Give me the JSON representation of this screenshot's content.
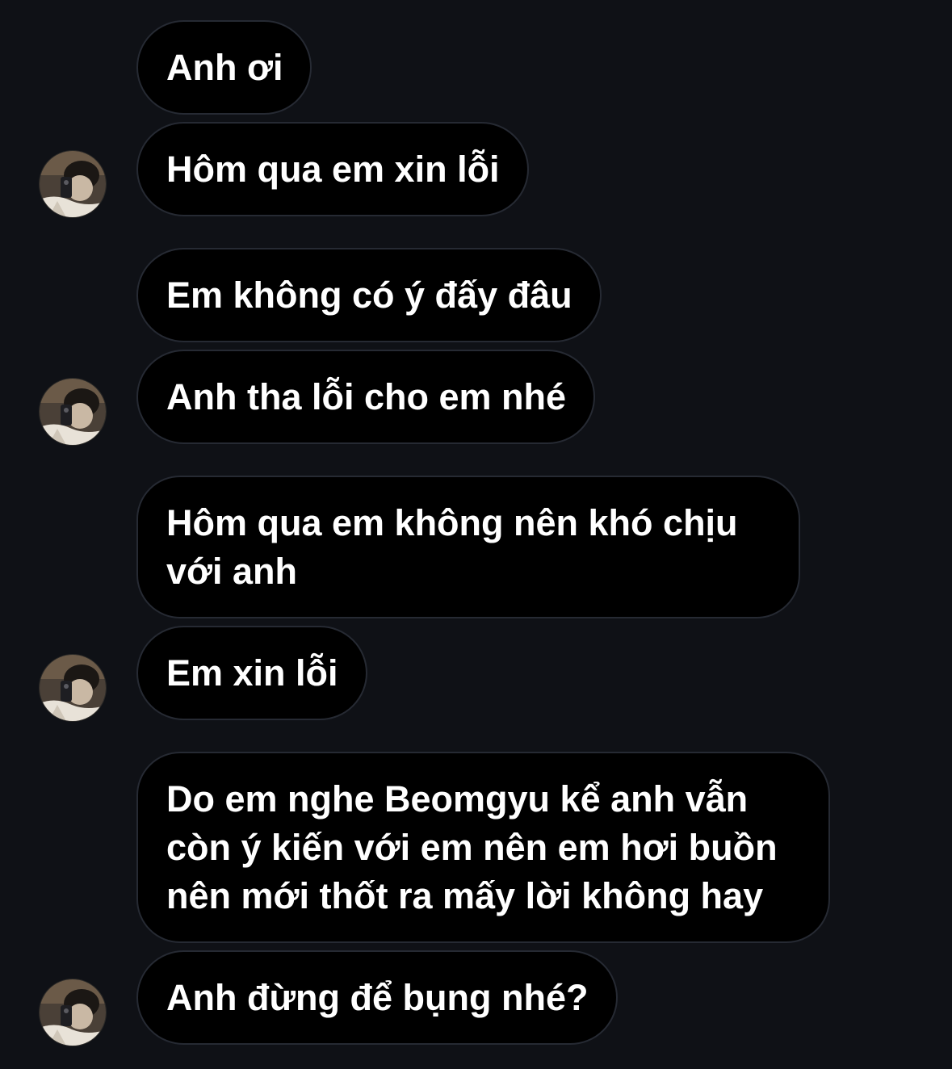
{
  "messages": [
    {
      "text_lines": [
        "Anh ơi"
      ]
    },
    {
      "text_lines": [
        "Hôm qua em xin lỗi"
      ]
    },
    {
      "text_lines": [
        "Em không có ý đấy đâu"
      ]
    },
    {
      "text_lines": [
        "Anh tha lỗi cho em nhé"
      ]
    },
    {
      "text_lines": [
        "Hôm qua em không nên khó chịu",
        "với anh"
      ]
    },
    {
      "text_lines": [
        "Em xin lỗi"
      ]
    },
    {
      "text_lines": [
        "Do em nghe Beomgyu kể anh vẫn",
        "còn ý kiến với em nên em hơi buồn",
        "nên mới thốt ra mấy lời không hay"
      ]
    },
    {
      "text_lines": [
        "Anh đừng để bụng nhé?"
      ]
    }
  ],
  "theme": {
    "background": "#0f1116",
    "bubble_fill": "#000000",
    "bubble_border": "#262a33",
    "text_color": "#ffffff"
  },
  "avatar": {
    "icon": "sender-avatar-photo-icon"
  }
}
